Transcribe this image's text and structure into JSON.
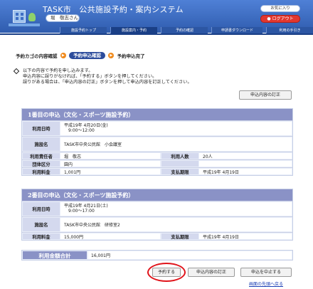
{
  "header": {
    "site_title": "TASK市　公共施設予約・案内システム",
    "user_name": "堀　敬志さん",
    "favorite_label": "お気に入り",
    "logout_label": "● ログアウト"
  },
  "nav": {
    "tabs": [
      {
        "label": "施設予約トップ"
      },
      {
        "label": "施設案内・予約"
      },
      {
        "label": "予約の確認"
      },
      {
        "label": "申請書ダウンロード"
      },
      {
        "label": "利用の手引き"
      }
    ]
  },
  "steps": {
    "step1": "予約カゴの内容確認",
    "step2": "予約申込確認",
    "step3": "予約申込完了",
    "arrow": "▶"
  },
  "instructions": {
    "line1": "以下の内容で予約を申し込みます。",
    "line2": "申込内容に誤りがなければ、「予約する」ボタンを押してください。",
    "line3": "誤りがある場合は、「申込内容の訂正」ボタンを押して申込内容を訂正してください。"
  },
  "buttons": {
    "edit_top": "申込内容の訂正",
    "reserve": "予約する",
    "edit_bottom": "申込内容の訂正",
    "cancel": "申込を中止する",
    "back_to_top": "画面の先頭へ戻る"
  },
  "application1": {
    "title": "1番目の申込（文化・スポーツ施設予約）",
    "date_label": "利用日時",
    "date_line1": "平成19年 4月20日(金)",
    "date_line2": "9:00～12:00",
    "facility_label": "施設名",
    "facility_value": "TASK市中央公民館　小会議室",
    "responsible_label": "利用責任者",
    "responsible_value": "堀　敬志",
    "people_label": "利用人数",
    "people_value": "20人",
    "area_label": "団体区分",
    "area_value": "園内",
    "fee_label": "利用料金",
    "fee_value": "1,001円",
    "deadline_label": "支払期限",
    "deadline_value": "平成19年 4月19日"
  },
  "application2": {
    "title": "2番目の申込（文化・スポーツ施設予約）",
    "date_label": "利用日時",
    "date_line1": "平成19年 4月21日(土)",
    "date_line2": "9:00～17:00",
    "facility_label": "施設名",
    "facility_value": "TASK市中央公民館　研修室2",
    "fee_label": "利用料金",
    "fee_value": "15,000円",
    "deadline_label": "支払期限",
    "deadline_value": "平成19年 4月19日"
  },
  "total": {
    "label": "利用金額合計",
    "value": "16,001円"
  },
  "colors": {
    "header_blue": "#3f6fc4",
    "section_header": "#8a92c6",
    "highlight_circle": "#e0131a",
    "logout_red": "#e2372f"
  }
}
